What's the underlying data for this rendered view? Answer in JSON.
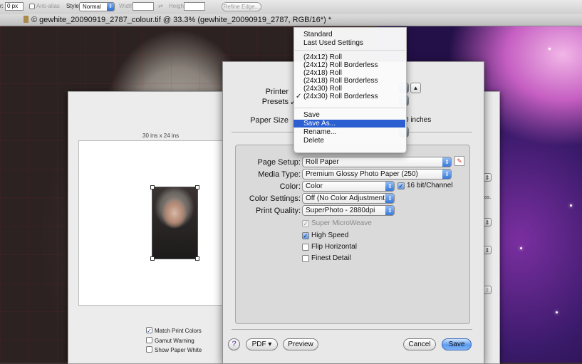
{
  "toolbar": {
    "feather_value": "0 px",
    "antialias_label": "Anti-alias",
    "style_label": "Style:",
    "style_value": "Normal",
    "width_label": "Width:",
    "width_value": "",
    "swap_icon": "swap-arrows-icon",
    "height_label": "Height:",
    "height_value": "",
    "refine_edge_label": "Refine Edge..."
  },
  "document": {
    "title": "© gewhite_20090919_2787_colour.tif @ 33.3% (gewhite_20090919_2787, RGB/16*) *"
  },
  "print_preview": {
    "size_label": "30 ins x 24 ins",
    "match_print_colors_label": "Match Print Colors",
    "match_print_colors_checked": true,
    "gamut_warning_label": "Gamut Warning",
    "gamut_warning_checked": false,
    "show_paper_white_label": "Show Paper White",
    "show_paper_white_checked": false,
    "side_text": "os."
  },
  "dialog": {
    "printer_label": "Printer",
    "presets_label": "Presets",
    "paper_size_label": "Paper Size",
    "paper_size_value_suffix": "0 inches",
    "page_setup_label": "Page Setup:",
    "page_setup_value": "Roll Paper",
    "media_type_label": "Media Type:",
    "media_type_value": "Premium Glossy Photo Paper (250)",
    "color_label": "Color:",
    "color_value": "Color",
    "bit_label": "16 bit/Channel",
    "bit_checked": true,
    "color_settings_label": "Color Settings:",
    "color_settings_value": "Off (No Color Adjustment)",
    "print_quality_label": "Print Quality:",
    "print_quality_value": "SuperPhoto - 2880dpi",
    "options": [
      {
        "label": "Super MicroWeave",
        "checked": true,
        "disabled": true
      },
      {
        "label": "High Speed",
        "checked": true,
        "disabled": false
      },
      {
        "label": "Flip Horizontal",
        "checked": false,
        "disabled": false
      },
      {
        "label": "Finest Detail",
        "checked": false,
        "disabled": false
      }
    ],
    "help_label": "?",
    "pdf_label": "PDF ▾",
    "preview_label": "Preview",
    "cancel_label": "Cancel",
    "save_label": "Save"
  },
  "presets_menu": {
    "group1": [
      "Standard",
      "Last Used Settings"
    ],
    "group2": [
      "(24x12) Roll",
      "(24x12) Roll Borderless",
      "(24x18) Roll",
      "(24x18) Roll Borderless",
      "(24x30) Roll",
      "(24x30) Roll Borderless"
    ],
    "checked_item": "(24x30) Roll Borderless",
    "group3": [
      "Save",
      "Save As...",
      "Rename...",
      "Delete"
    ],
    "highlighted_item": "Save As...",
    "highlight_color": "#2b5fd1"
  }
}
